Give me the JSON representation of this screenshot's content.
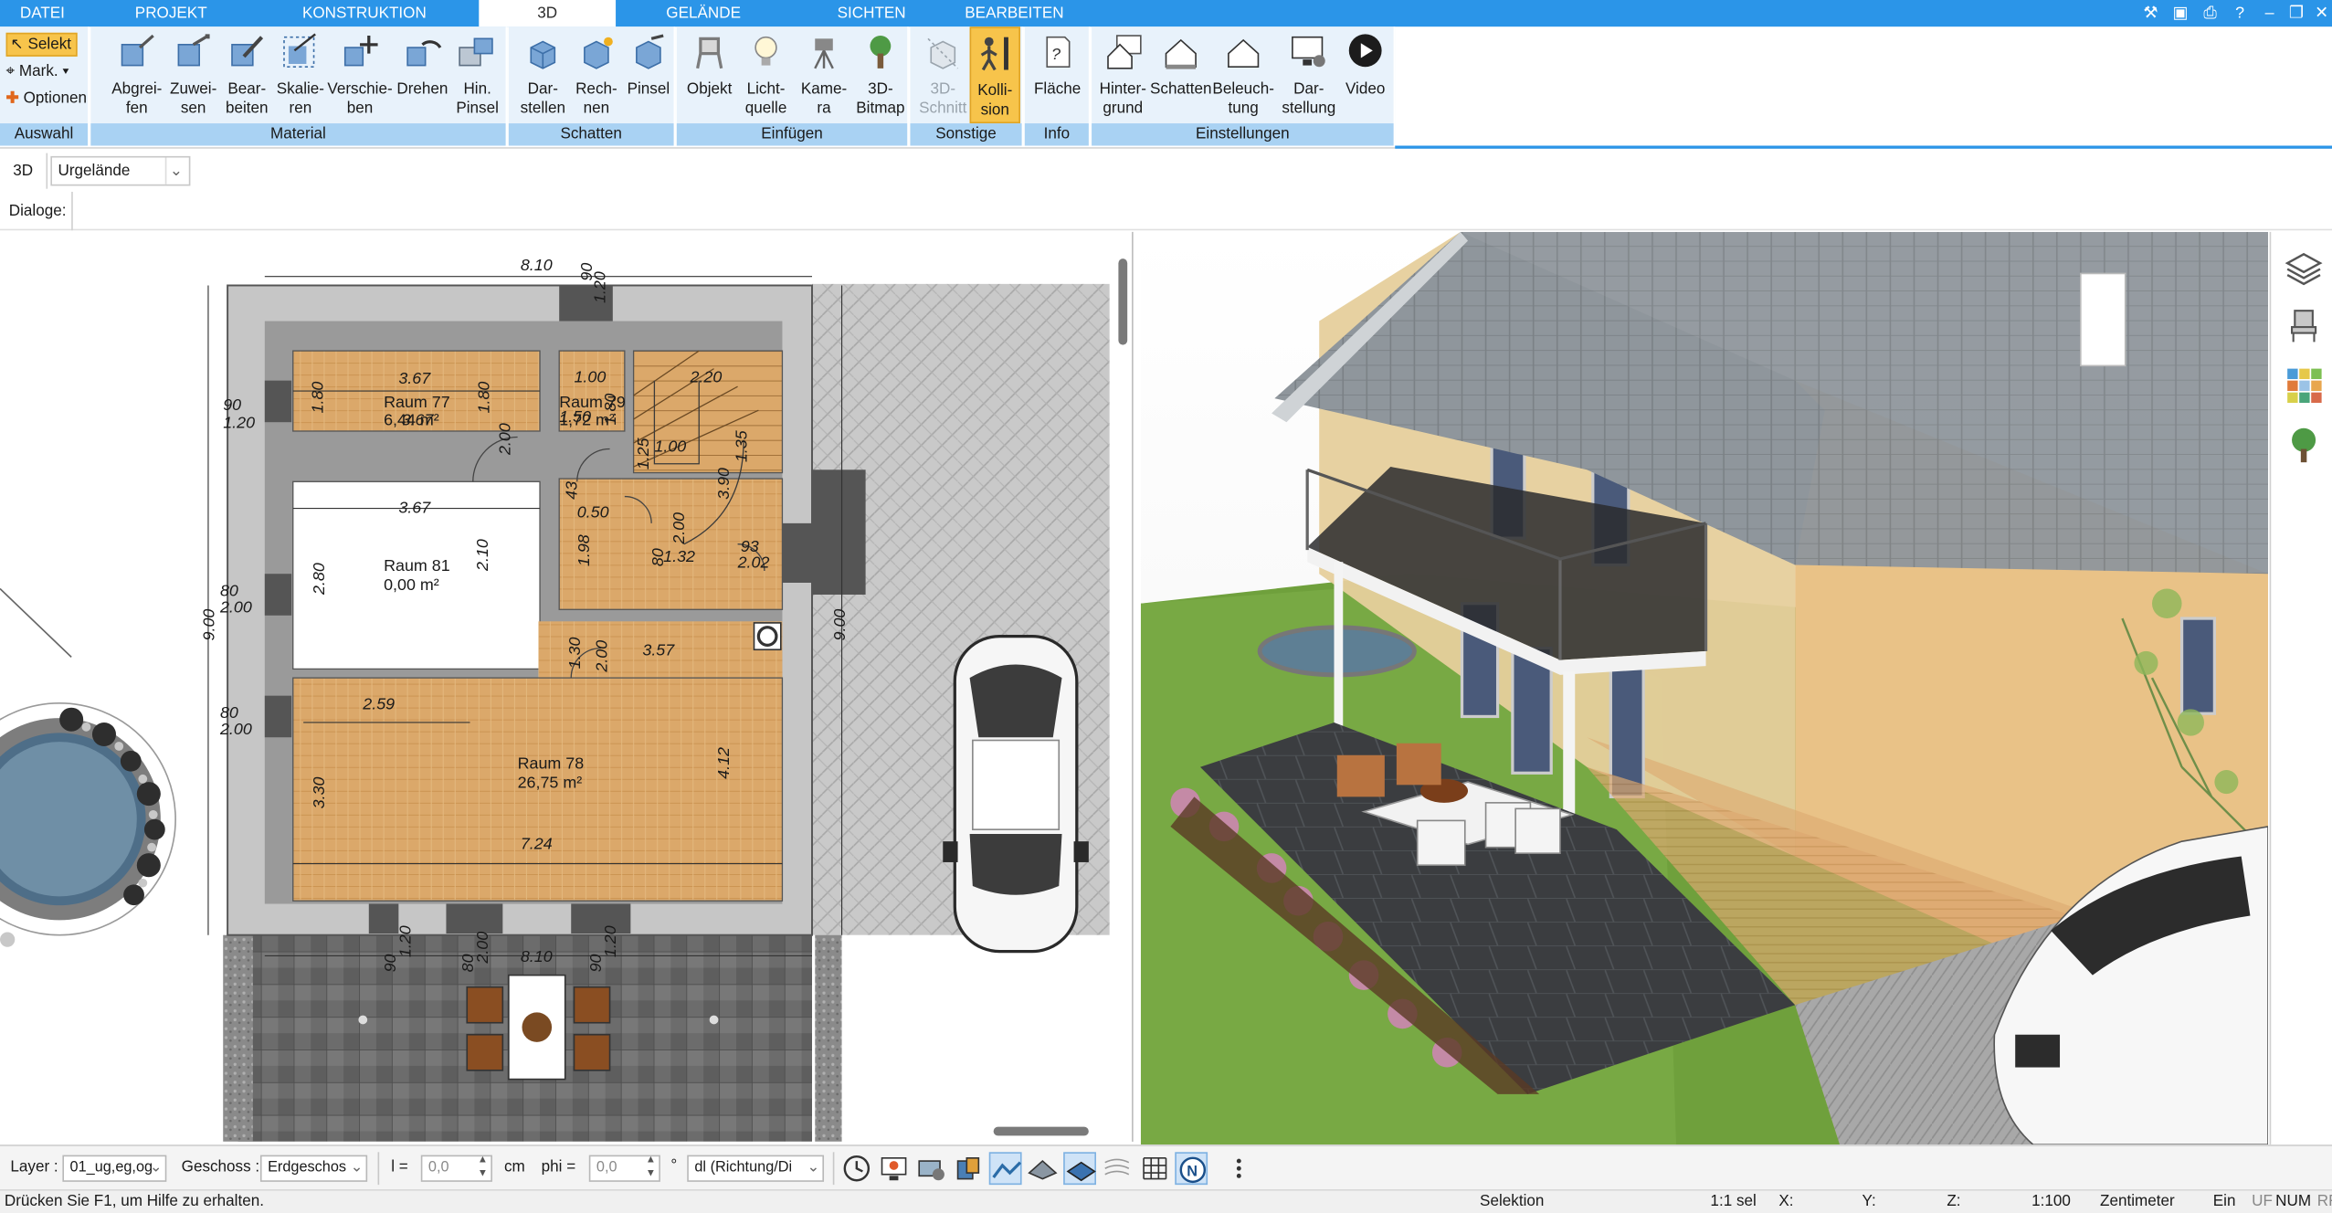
{
  "menu": {
    "tabs": [
      {
        "label": "DATEI"
      },
      {
        "label": "PROJEKT"
      },
      {
        "label": "KONSTRUKTION"
      },
      {
        "label": "3D"
      },
      {
        "label": "GELÄNDE"
      },
      {
        "label": "SICHTEN"
      },
      {
        "label": "BEARBEITEN"
      }
    ],
    "active_tab": "3D"
  },
  "ribbon": {
    "auswahl": {
      "label": "Auswahl",
      "selekt": "Selekt",
      "mark": "Mark.",
      "optionen": "Optionen"
    },
    "material": {
      "label": "Material",
      "buttons": [
        "Abgrei-\nfen",
        "Zuwei-\nsen",
        "Bear-\nbeiten",
        "Skalie-\nren",
        "Verschie-\nben",
        "Drehen",
        "Hin.\nPinsel"
      ]
    },
    "schatten": {
      "label": "Schatten",
      "buttons": [
        "Dar-\nstellen",
        "Rech-\nnen",
        "Pinsel"
      ]
    },
    "einfuegen": {
      "label": "Einfügen",
      "buttons": [
        "Objekt",
        "Licht-\nquelle",
        "Kame-\nra",
        "3D-\nBitmap"
      ]
    },
    "sonstige": {
      "label": "Sonstige",
      "buttons": [
        "3D-\nSchnitt",
        "Kolli-\nsion"
      ]
    },
    "info": {
      "label": "Info",
      "buttons": [
        "Fläche"
      ]
    },
    "einstellungen": {
      "label": "Einstellungen",
      "buttons": [
        "Hinter-\ngrund",
        "Schatten",
        "Beleuch-\ntung",
        "Dar-\nstellung",
        "Video"
      ]
    }
  },
  "toolbar3d": {
    "label": "3D",
    "dropdown": "Urgelände"
  },
  "dialoge": {
    "label": "Dialoge:"
  },
  "floorplan": {
    "dims": {
      "top": "8.10",
      "left": "9.00",
      "right": "9.00",
      "bottom": "8.10",
      "d120a": "1.20",
      "d120b": "1.20",
      "d90a": "90",
      "d90b": "90",
      "d90c": "90",
      "d80a": "80",
      "d80b": "80",
      "d80c": "80",
      "d200a": "2.00",
      "d200b": "2.00",
      "d200c": "2.00",
      "d200d": "2.00",
      "d180a": "1.80",
      "d180b": "1.80",
      "d180c": "1.80",
      "d367a": "3.67",
      "d367b": "3.67",
      "d367c": "3.67",
      "d100a": "1.00",
      "d100b": "1.00",
      "d220": "2.20",
      "d210": "2.10",
      "d280": "2.80",
      "d259": "2.59",
      "d330": "3.30",
      "d724": "7.24",
      "d412": "4.12",
      "d357": "3.57",
      "d390": "3.90",
      "d202": "2.02",
      "d93": "93",
      "d198": "1.98",
      "d050": "0.50",
      "d135": "1.35",
      "d125": "1.25",
      "d132": "1.32",
      "d130": "1.30",
      "d2000": "2.00",
      "d150": "1.50",
      "d43": "43",
      "d80d": "80"
    },
    "rooms": [
      {
        "name": "Raum 77",
        "area": "6,44 m²"
      },
      {
        "name": "Raum 79",
        "area": "1,72 m²"
      },
      {
        "name": "Raum 81",
        "area": "0,00 m²"
      },
      {
        "name": "Raum 78",
        "area": "26,75 m²"
      }
    ]
  },
  "sidebar_icons": [
    "layers-icon",
    "furniture-icon",
    "materials-icon",
    "tree-icon"
  ],
  "bottom": {
    "layer_label": "Layer :",
    "layer_value": "01_ug,eg,og",
    "geschoss_label": "Geschoss :",
    "geschoss_value": "Erdgeschos",
    "l_label": "l =",
    "l_value": "0,0",
    "l_unit": "cm",
    "phi_label": "phi =",
    "phi_value": "0,0",
    "phi_unit": "°",
    "mode_value": "dl (Richtung/Di"
  },
  "status": {
    "help": "Drücken Sie F1, um Hilfe zu erhalten.",
    "mode": "Selektion",
    "sel": "1:1 sel",
    "x": "X:",
    "y": "Y:",
    "z": "Z:",
    "scale": "1:100",
    "unit": "Zentimeter",
    "ein": "Ein",
    "uf": "UF",
    "num": "NUM",
    "rf": "RF"
  },
  "colors": {
    "menubar": "#2b95e8",
    "ribbon_group": "#e8f2fb",
    "ribbon_label": "#a9d2f3",
    "active_toggle": "#f7c44b",
    "wood_floor": "#d9a86a",
    "paving": "#c8c8c8"
  }
}
